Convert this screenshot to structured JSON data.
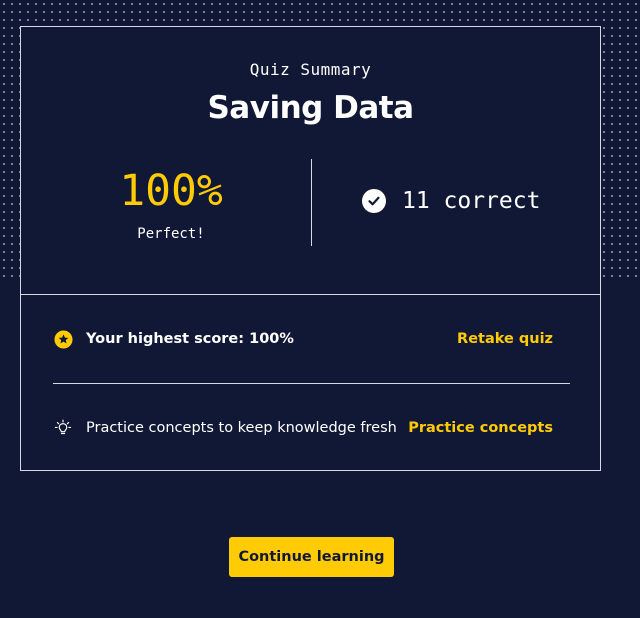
{
  "summary": {
    "eyebrow": "Quiz Summary",
    "title": "Saving Data",
    "score_percent": "100%",
    "score_label": "Perfect!",
    "correct_text": "11 correct"
  },
  "highest_score": {
    "text": "Your highest score: 100%",
    "action_label": "Retake quiz",
    "icon": "star-badge-icon"
  },
  "practice": {
    "text": "Practice concepts to keep knowledge fresh",
    "action_label": "Practice concepts",
    "icon": "lightbulb-icon"
  },
  "continue_button": {
    "label": "Continue learning"
  },
  "colors": {
    "background": "#111835",
    "accent": "#ffcb05",
    "text": "#ffffff",
    "border": "#d7d9e2"
  }
}
